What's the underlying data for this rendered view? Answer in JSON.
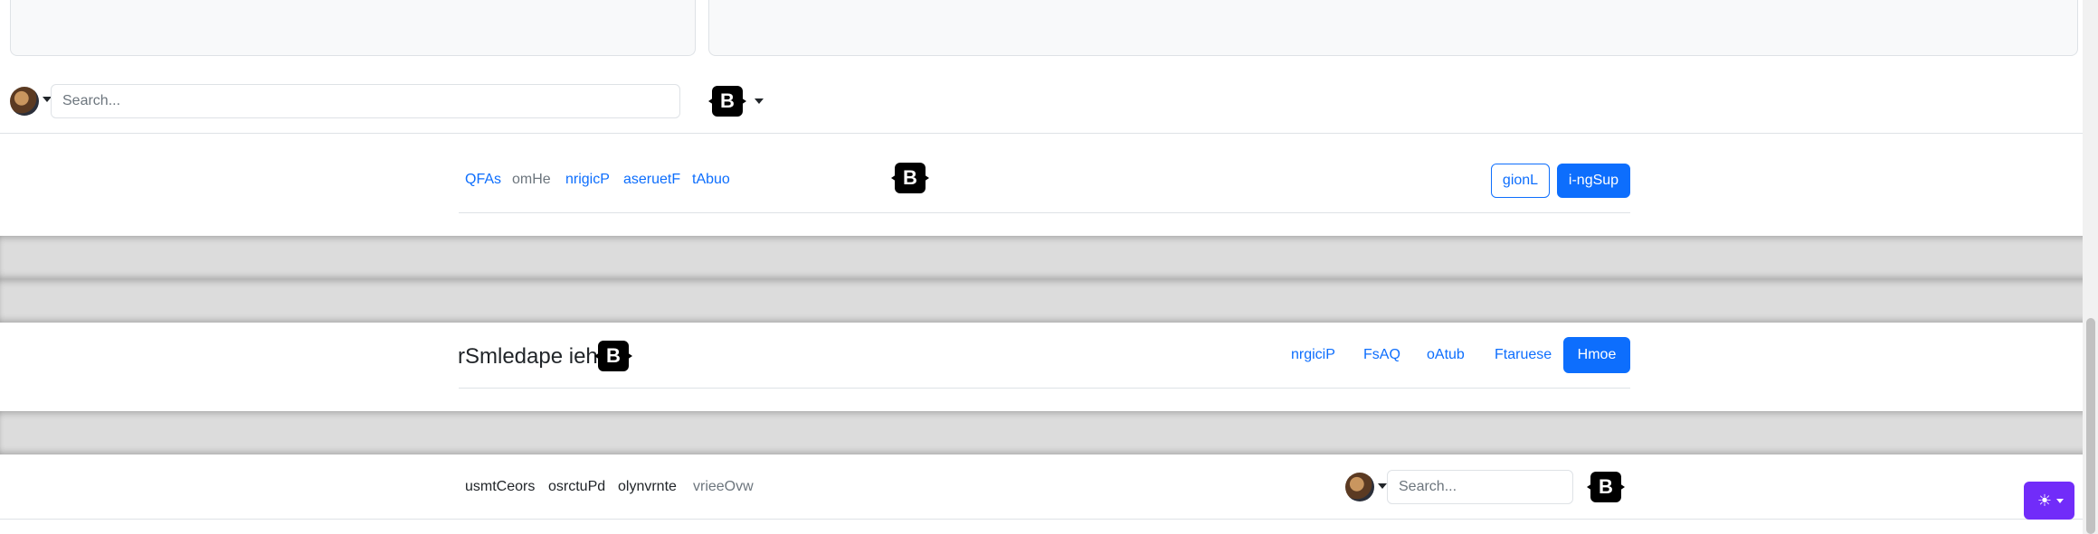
{
  "header1": {
    "search_placeholder": "Search...",
    "brand_letter": "B"
  },
  "header2": {
    "nav": [
      "QFAs",
      "omHe",
      "nrigicP",
      "aseruetF",
      "tAbuo"
    ],
    "brand_letter": "B",
    "login_label": "gionL",
    "signup_label": "i-ngSup"
  },
  "header3": {
    "title": "rSmledape ieh",
    "brand_letter": "B",
    "nav": [
      "nrgiciP",
      "FsAQ",
      "oAtub",
      "Ftaruese"
    ],
    "home_label": "Hmoe"
  },
  "header4": {
    "nav": [
      "usmtCeors",
      "osrctuPd",
      "olynvrnte",
      "vrieeOvw"
    ],
    "search_placeholder": "Search...",
    "brand_letter": "B"
  },
  "theme": {
    "icon": "sun-icon",
    "accent": "#712cf9"
  },
  "colors": {
    "primary": "#0d6efd",
    "muted": "#6c757d"
  }
}
